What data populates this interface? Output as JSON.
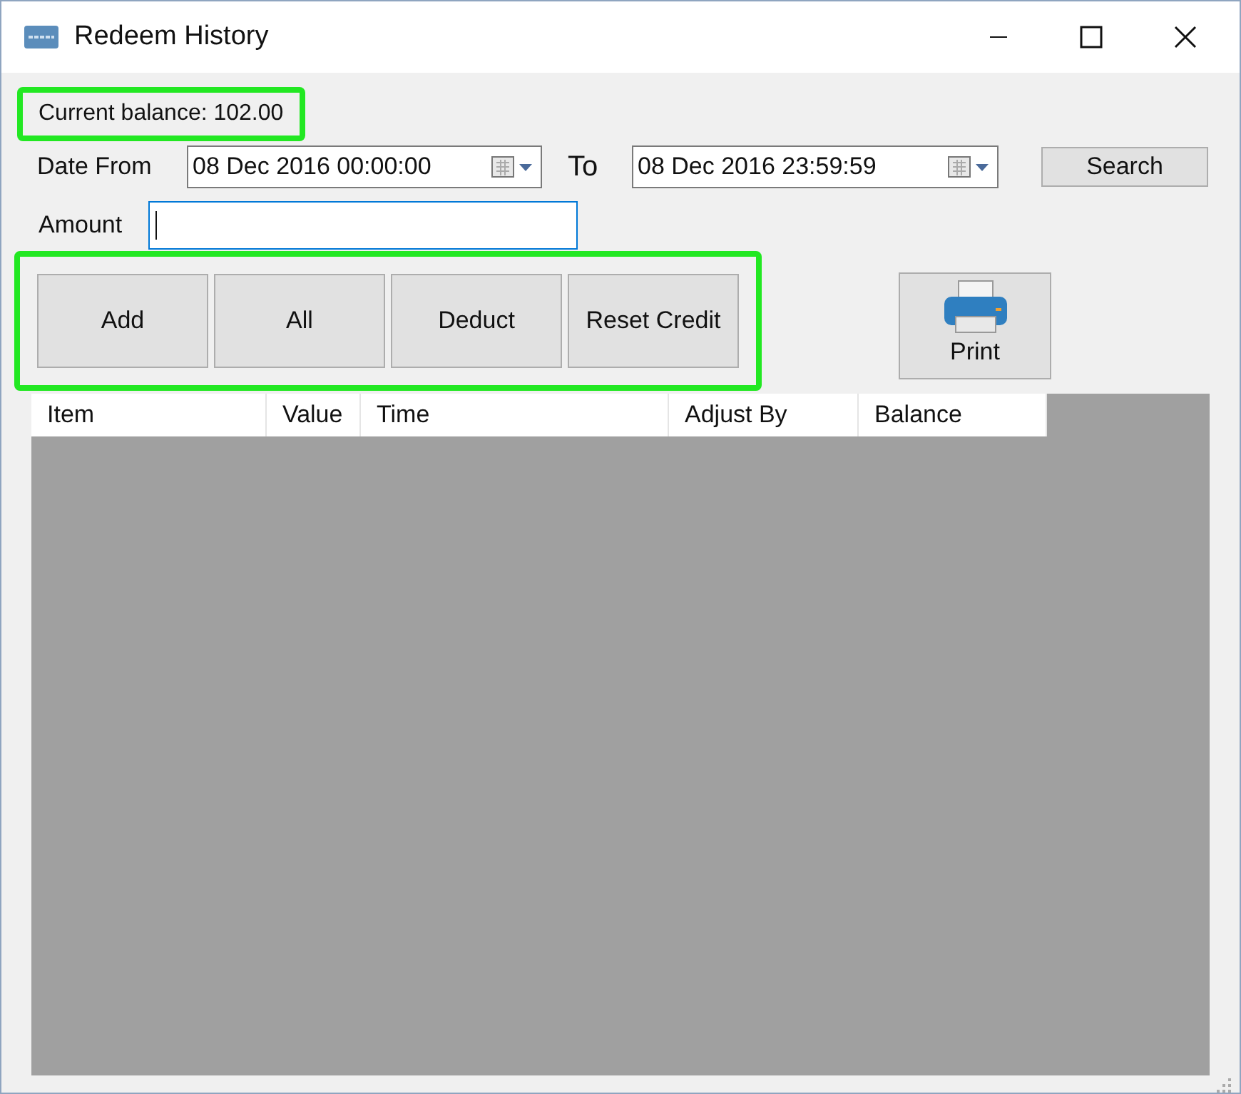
{
  "window": {
    "title": "Redeem History"
  },
  "balance": {
    "label": "Current balance: 102.00",
    "highlighted": true
  },
  "date_from": {
    "label": "Date From",
    "value": "08 Dec 2016 00:00:00"
  },
  "date_to": {
    "label": "To",
    "value": "08 Dec 2016 23:59:59"
  },
  "search_button": "Search",
  "amount": {
    "label": "Amount"
  },
  "action_buttons": {
    "highlighted": true,
    "items": [
      "Add",
      "All",
      "Deduct",
      "Reset Credit"
    ]
  },
  "print_button": "Print",
  "table": {
    "columns": [
      "Item",
      "Value",
      "Time",
      "Adjust By",
      "Balance"
    ]
  }
}
